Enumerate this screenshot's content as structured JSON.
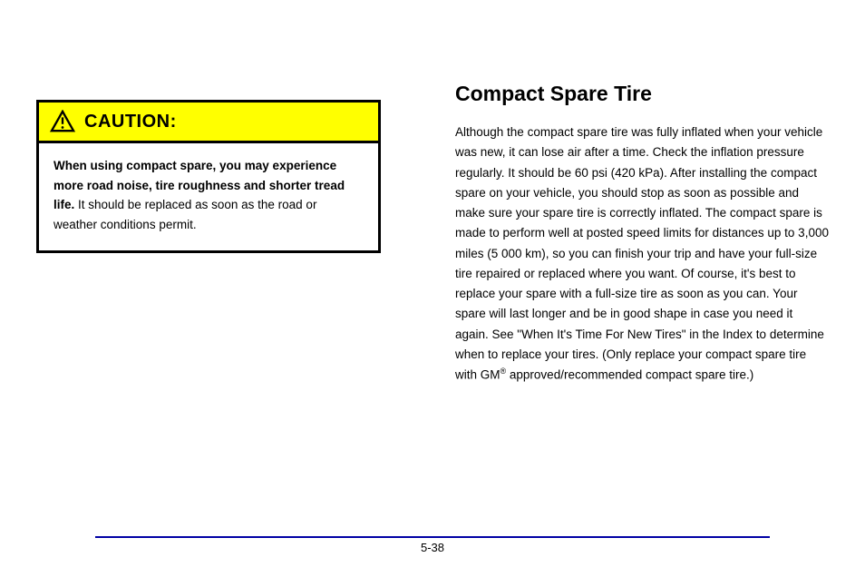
{
  "leftColumn": {
    "caution": {
      "title": "CAUTION:",
      "boldText": "When using compact spare, you may experience more road noise, tire roughness and shorter tread life.",
      "normalText": " It should be replaced as soon as the road or weather conditions permit."
    }
  },
  "rightColumn": {
    "title": "Compact Spare Tire",
    "paragraph": "Although the compact spare tire was fully inflated when your vehicle was new, it can lose air after a time. Check the inflation pressure regularly. It should be 60 psi (420 kPa). After installing the compact spare on your vehicle, you should stop as soon as possible and make sure your spare tire is correctly inflated. The compact spare is made to perform well at posted speed limits for distances up to 3,000 miles (5 000 km), so you can finish your trip and have your full",
    "regMark": "®",
    "beforeReg": "-size tire repaired or replaced where you want. Of course, it's best to replace your spare with a full-size tire as soon as you can. Your spare will last longer and be in good shape in case you need it again. See \"When It's Time For New Tires\" in the Index to determine when to replace your tires. (Only replace your compact spare tire with GM",
    "afterReg": " approved/recommended compact spare tire.)"
  },
  "pageNumber": "5-38"
}
